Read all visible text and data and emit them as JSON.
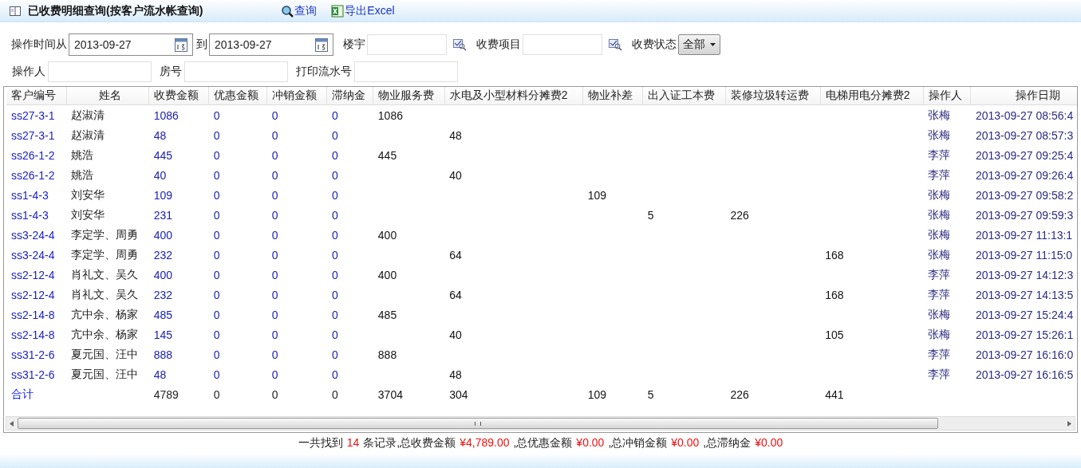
{
  "title": "已收费明细查询(按客户流水帐查询)",
  "actions": [
    {
      "kind": "search",
      "label": "查询"
    },
    {
      "kind": "excel",
      "label": "导出Excel"
    }
  ],
  "filters_row1": {
    "time_from_label": "操作时间从",
    "date_from": "2013-09-27",
    "to_label": "到",
    "date_to": "2013-09-27",
    "building_label": "楼宇",
    "item_label": "收费项目",
    "status_label": "收费状态",
    "status_value": "全部"
  },
  "filters_row2": [
    {
      "label": "操作人"
    },
    {
      "label": "房号"
    },
    {
      "label": "打印流水号"
    }
  ],
  "table": {
    "columns": [
      "客户编号",
      "姓名",
      "收费金额",
      "优惠金额",
      "冲销金额",
      "滞纳金",
      "物业服务费",
      "水电及小型材料分摊费2",
      "物业补差",
      "出入证工本费",
      "装修垃圾转运费",
      "电梯用电分摊费2",
      "操作人",
      "操作日期"
    ],
    "rows": [
      [
        "ss27-3-1",
        "赵淑清",
        "1086",
        "0",
        "0",
        "0",
        "1086",
        null,
        null,
        null,
        null,
        null,
        "张梅",
        "2013-09-27 08:56:4"
      ],
      [
        "ss27-3-1",
        "赵淑清",
        "48",
        "0",
        "0",
        "0",
        null,
        "48",
        null,
        null,
        null,
        null,
        "张梅",
        "2013-09-27 08:57:3"
      ],
      [
        "ss26-1-2",
        "姚浩",
        "445",
        "0",
        "0",
        "0",
        "445",
        null,
        null,
        null,
        null,
        null,
        "李萍",
        "2013-09-27 09:25:4"
      ],
      [
        "ss26-1-2",
        "姚浩",
        "40",
        "0",
        "0",
        "0",
        null,
        "40",
        null,
        null,
        null,
        null,
        "李萍",
        "2013-09-27 09:26:4"
      ],
      [
        "ss1-4-3",
        "刘安华",
        "109",
        "0",
        "0",
        "0",
        null,
        null,
        "109",
        null,
        null,
        null,
        "张梅",
        "2013-09-27 09:58:2"
      ],
      [
        "ss1-4-3",
        "刘安华",
        "231",
        "0",
        "0",
        "0",
        null,
        null,
        null,
        "5",
        "226",
        null,
        "张梅",
        "2013-09-27 09:59:3"
      ],
      [
        "ss3-24-4",
        "李定学、周勇",
        "400",
        "0",
        "0",
        "0",
        "400",
        null,
        null,
        null,
        null,
        null,
        "张梅",
        "2013-09-27 11:13:1"
      ],
      [
        "ss3-24-4",
        "李定学、周勇",
        "232",
        "0",
        "0",
        "0",
        null,
        "64",
        null,
        null,
        null,
        "168",
        "张梅",
        "2013-09-27 11:15:0"
      ],
      [
        "ss2-12-4",
        "肖礼文、吴久",
        "400",
        "0",
        "0",
        "0",
        "400",
        null,
        null,
        null,
        null,
        null,
        "李萍",
        "2013-09-27 14:12:3"
      ],
      [
        "ss2-12-4",
        "肖礼文、吴久",
        "232",
        "0",
        "0",
        "0",
        null,
        "64",
        null,
        null,
        null,
        "168",
        "李萍",
        "2013-09-27 14:13:5"
      ],
      [
        "ss2-14-8",
        "亢中余、杨家",
        "485",
        "0",
        "0",
        "0",
        "485",
        null,
        null,
        null,
        null,
        null,
        "张梅",
        "2013-09-27 15:24:4"
      ],
      [
        "ss2-14-8",
        "亢中余、杨家",
        "145",
        "0",
        "0",
        "0",
        null,
        "40",
        null,
        null,
        null,
        "105",
        "张梅",
        "2013-09-27 15:26:1"
      ],
      [
        "ss31-2-6",
        "夏元国、汪中",
        "888",
        "0",
        "0",
        "0",
        "888",
        null,
        null,
        null,
        null,
        null,
        "李萍",
        "2013-09-27 16:16:0"
      ],
      [
        "ss31-2-6",
        "夏元国、汪中",
        "48",
        "0",
        "0",
        "0",
        null,
        "48",
        null,
        null,
        null,
        null,
        "李萍",
        "2013-09-27 16:16:5"
      ]
    ],
    "total": {
      "label": "合计",
      "values": [
        "4789",
        "0",
        "0",
        "0",
        "3704",
        "304",
        "109",
        "5",
        "226",
        "441"
      ]
    }
  },
  "summary": [
    {
      "kind": "label",
      "text": "一共找到"
    },
    {
      "kind": "value",
      "text": "14"
    },
    {
      "kind": "label",
      "text": "条记录,总收费金额"
    },
    {
      "kind": "value",
      "text": "¥4,789.00"
    },
    {
      "kind": "label",
      "text": ",总优惠金额"
    },
    {
      "kind": "value",
      "text": "¥0.00"
    },
    {
      "kind": "label",
      "text": ",总冲销金额"
    },
    {
      "kind": "value",
      "text": "¥0.00"
    },
    {
      "kind": "label",
      "text": ",总滞纳金"
    },
    {
      "kind": "value",
      "text": "¥0.00"
    }
  ]
}
